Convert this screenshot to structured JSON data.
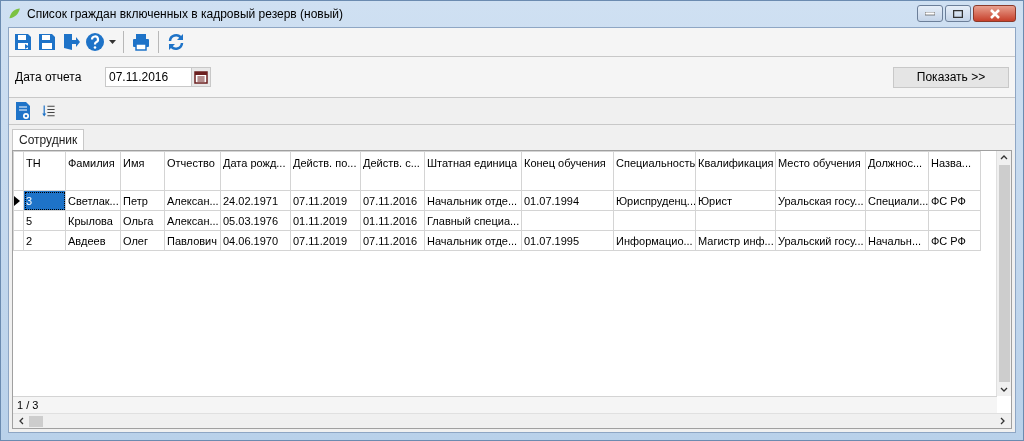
{
  "window": {
    "title": "Список граждан включенных в кадровый резерв (новый)"
  },
  "filter": {
    "label": "Дата отчета",
    "date": "07.11.2016",
    "show_button": "Показать >>"
  },
  "tabs": [
    {
      "label": "Сотрудник",
      "selected": true
    }
  ],
  "table": {
    "columns": [
      "ТН",
      "Фамилия",
      "Имя",
      "Отчество",
      "Дата рожд...",
      "Действ. по...",
      "Действ. с...",
      "Штатная единица",
      "Конец обучения",
      "Специальность",
      "Квалификация",
      "Место обучения",
      "Должнос...",
      "Назва..."
    ],
    "rows": [
      {
        "selected": true,
        "cells": [
          "3",
          "Светлак...",
          "Петр",
          "Алексан...",
          "24.02.1971",
          "07.11.2019",
          "07.11.2016",
          "Начальник отде...",
          "01.07.1994",
          "Юриспруденц...",
          "Юрист",
          "Уральская госу...",
          "Специали...",
          "ФС РФ"
        ]
      },
      {
        "selected": false,
        "cells": [
          "5",
          "Крылова",
          "Ольга",
          "Алексан...",
          "05.03.1976",
          "01.11.2019",
          "01.11.2016",
          "Главный специа...",
          "",
          "",
          "",
          "",
          "",
          ""
        ]
      },
      {
        "selected": false,
        "cells": [
          "2",
          "Авдеев",
          "Олег",
          "Павлович",
          "04.06.1970",
          "07.11.2019",
          "07.11.2016",
          "Начальник отде...",
          "01.07.1995",
          "Информацио...",
          "Магистр инф...",
          "Уральский госу...",
          "Начальн...",
          "ФС РФ"
        ]
      }
    ]
  },
  "status_bar": {
    "record_counter": "1 / 3"
  }
}
